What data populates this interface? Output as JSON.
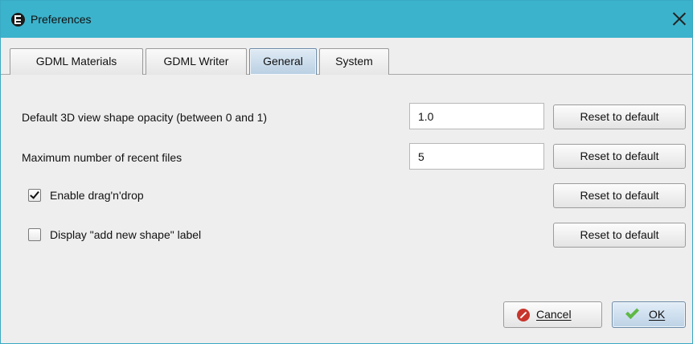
{
  "window": {
    "title": "Preferences",
    "app_icon": "app-e-icon",
    "close_icon": "close-icon",
    "titlebar_color": "#3cb3cc"
  },
  "tabs": [
    {
      "label": "GDML Materials",
      "active": false
    },
    {
      "label": "GDML Writer",
      "active": false
    },
    {
      "label": "General",
      "active": true
    },
    {
      "label": "System",
      "active": false
    }
  ],
  "settings": {
    "opacity": {
      "label": "Default 3D view shape opacity (between 0 and 1)",
      "value": "1.0",
      "reset_label": "Reset to default"
    },
    "recent_files": {
      "label": "Maximum number of recent files",
      "value": "5",
      "reset_label": "Reset to default"
    },
    "drag_drop": {
      "label": "Enable drag'n'drop",
      "checked": true,
      "reset_label": "Reset to default"
    },
    "shape_label": {
      "label": "Display \"add new shape\" label",
      "checked": false,
      "reset_label": "Reset to default"
    }
  },
  "footer": {
    "cancel_label": "Cancel",
    "cancel_icon": "cancel-icon",
    "ok_label": "OK",
    "ok_icon": "checkmark-icon"
  }
}
